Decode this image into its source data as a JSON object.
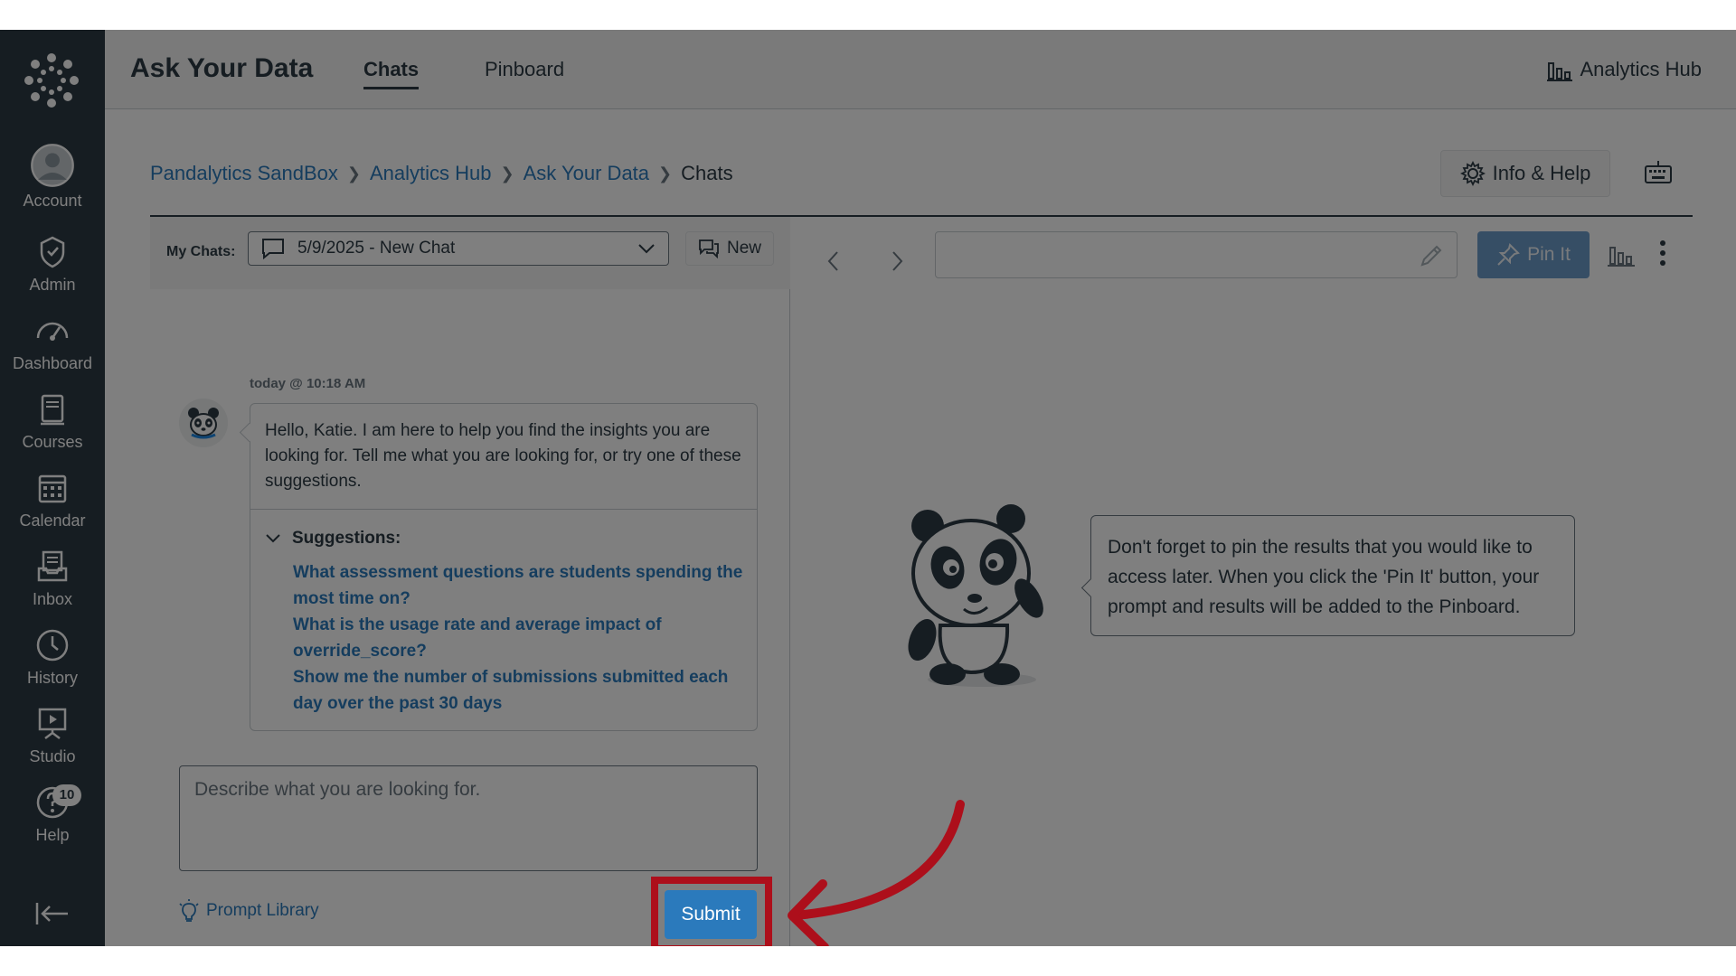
{
  "nav": {
    "items": [
      {
        "label": "Account",
        "icon": "avatar-icon"
      },
      {
        "label": "Admin",
        "icon": "shield-icon"
      },
      {
        "label": "Dashboard",
        "icon": "speedometer-icon"
      },
      {
        "label": "Courses",
        "icon": "book-icon"
      },
      {
        "label": "Calendar",
        "icon": "calendar-icon"
      },
      {
        "label": "Inbox",
        "icon": "inbox-icon"
      },
      {
        "label": "History",
        "icon": "clock-icon"
      },
      {
        "label": "Studio",
        "icon": "studio-icon"
      },
      {
        "label": "Help",
        "icon": "help-icon"
      }
    ],
    "help_badge": "10"
  },
  "header": {
    "title": "Ask Your Data",
    "tabs": [
      {
        "label": "Chats",
        "active": true
      },
      {
        "label": "Pinboard",
        "active": false
      }
    ],
    "hub_link": "Analytics Hub"
  },
  "breadcrumb": {
    "links": [
      "Pandalytics SandBox",
      "Analytics Hub",
      "Ask Your Data"
    ],
    "current": "Chats"
  },
  "info_help_label": "Info & Help",
  "chat": {
    "my_chats_label": "My Chats:",
    "selected_chat": "5/9/2025 - New Chat",
    "new_label": "New",
    "timestamp": "today @ 10:18 AM",
    "greeting": "Hello, Katie. I am here to help you find the insights you are looking for. Tell me what you are looking for, or try one of these suggestions.",
    "suggestions_label": "Suggestions:",
    "suggestions": [
      "What assessment questions are students spending the most time on?",
      "What is the usage rate and average impact of override_score?",
      "Show me the number of submissions submitted each day over the past 30 days"
    ],
    "prompt_placeholder": "Describe what you are looking for.",
    "prompt_library_label": "Prompt Library",
    "submit_label": "Submit"
  },
  "results": {
    "pin_label": "Pin It",
    "tip_text": "Don't forget to pin the results that you would like to access later. When you click the 'Pin It' button, your prompt and results will be added to the Pinboard."
  },
  "colors": {
    "nav_bg": "#2d3b45",
    "link": "#2b7abc",
    "accent_button": "#2b7abc",
    "highlight": "#ad0f1b"
  }
}
